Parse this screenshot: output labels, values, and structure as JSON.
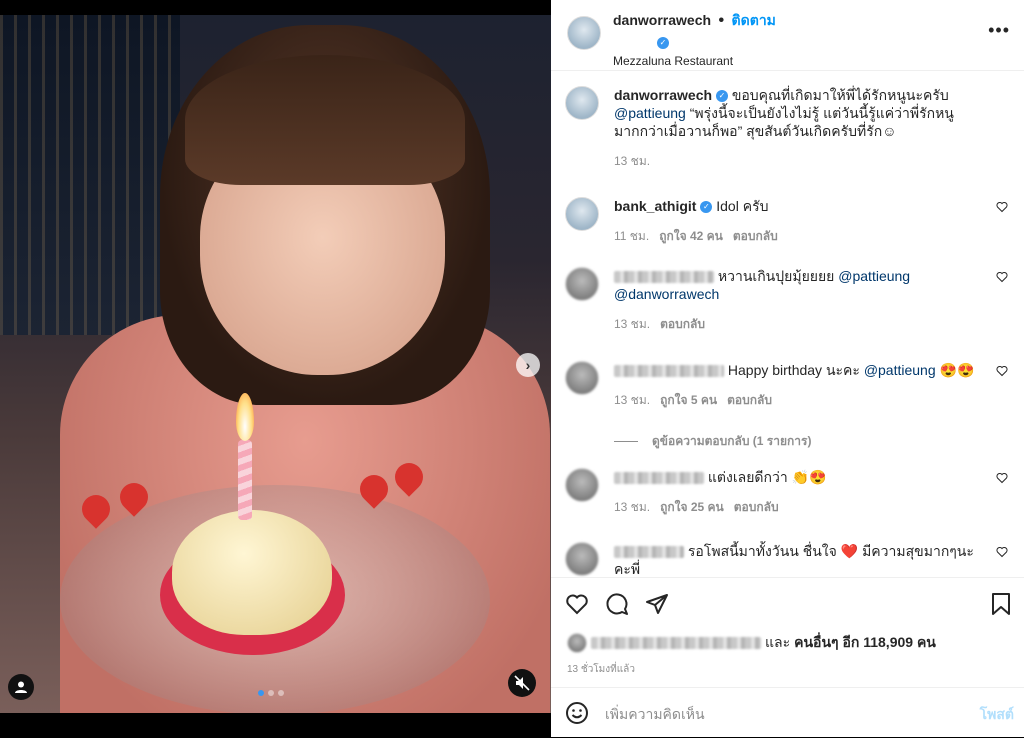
{
  "media": {
    "carousel_dots": 3,
    "active_dot": 0
  },
  "header": {
    "username": "danworrawech",
    "separator": "•",
    "follow_label": "ติดตาม",
    "location": "Mezzaluna Restaurant",
    "more_icon": "more-horizontal-icon"
  },
  "caption": {
    "username": "danworrawech",
    "text_1": "ขอบคุณที่เกิดมาให้พี่ได้รักหนูนะครับ",
    "mention": "@pattieung",
    "text_2": "“พรุ่งนี้จะเป็นยังไงไม่รู้ แต่วันนี้รู้แค่ว่าพี่รักหนูมากกว่าเมื่อวานก็พอ” สุขสันต์วันเกิดครับที่รัก☺",
    "time": "13 ชม."
  },
  "comments": [
    {
      "username": "bank_athigit",
      "verified": true,
      "text": "Idol ครับ",
      "time": "11 ชม.",
      "likes": "ถูกใจ 42 คน",
      "reply": "ตอบกลับ"
    },
    {
      "username": "",
      "text": "หวานเกินปุยมุ้ยยยย",
      "mention1": "@pattieung",
      "mention2": "@danworrawech",
      "time": "13 ชม.",
      "reply": "ตอบกลับ"
    },
    {
      "username": "",
      "text": "Happy birthday นะคะ",
      "mention1": "@pattieung",
      "emoji": "😍😍",
      "time": "13 ชม.",
      "likes": "ถูกใจ 5 คน",
      "reply": "ตอบกลับ",
      "view_replies": "ดูข้อความตอบกลับ (1 รายการ)"
    },
    {
      "username": "",
      "text": "แต่งเลยดีกว่า",
      "emoji": "👏😍",
      "time": "13 ชม.",
      "likes": "ถูกใจ 25 คน",
      "reply": "ตอบกลับ"
    },
    {
      "username": "",
      "text": "รอโพสนี้มาทั้งวันน ชื่นใจ",
      "emoji": "❤️",
      "text_2": "มีความสุขมากๆนะคะพี่"
    }
  ],
  "actions": {
    "liked_by_suffix": "และ",
    "others_label": "คนอื่นๆ อีก 118,909 คน",
    "time_ago": "13 ชั่วโมงที่แล้ว"
  },
  "add_comment": {
    "placeholder": "เพิ่มความคิดเห็น",
    "post_label": "โพสต์"
  },
  "colors": {
    "verified": "#3897f0",
    "follow": "#0095f6",
    "mention": "#00376b",
    "muted": "#8e8e8e",
    "post_disabled": "#b2dffc"
  }
}
